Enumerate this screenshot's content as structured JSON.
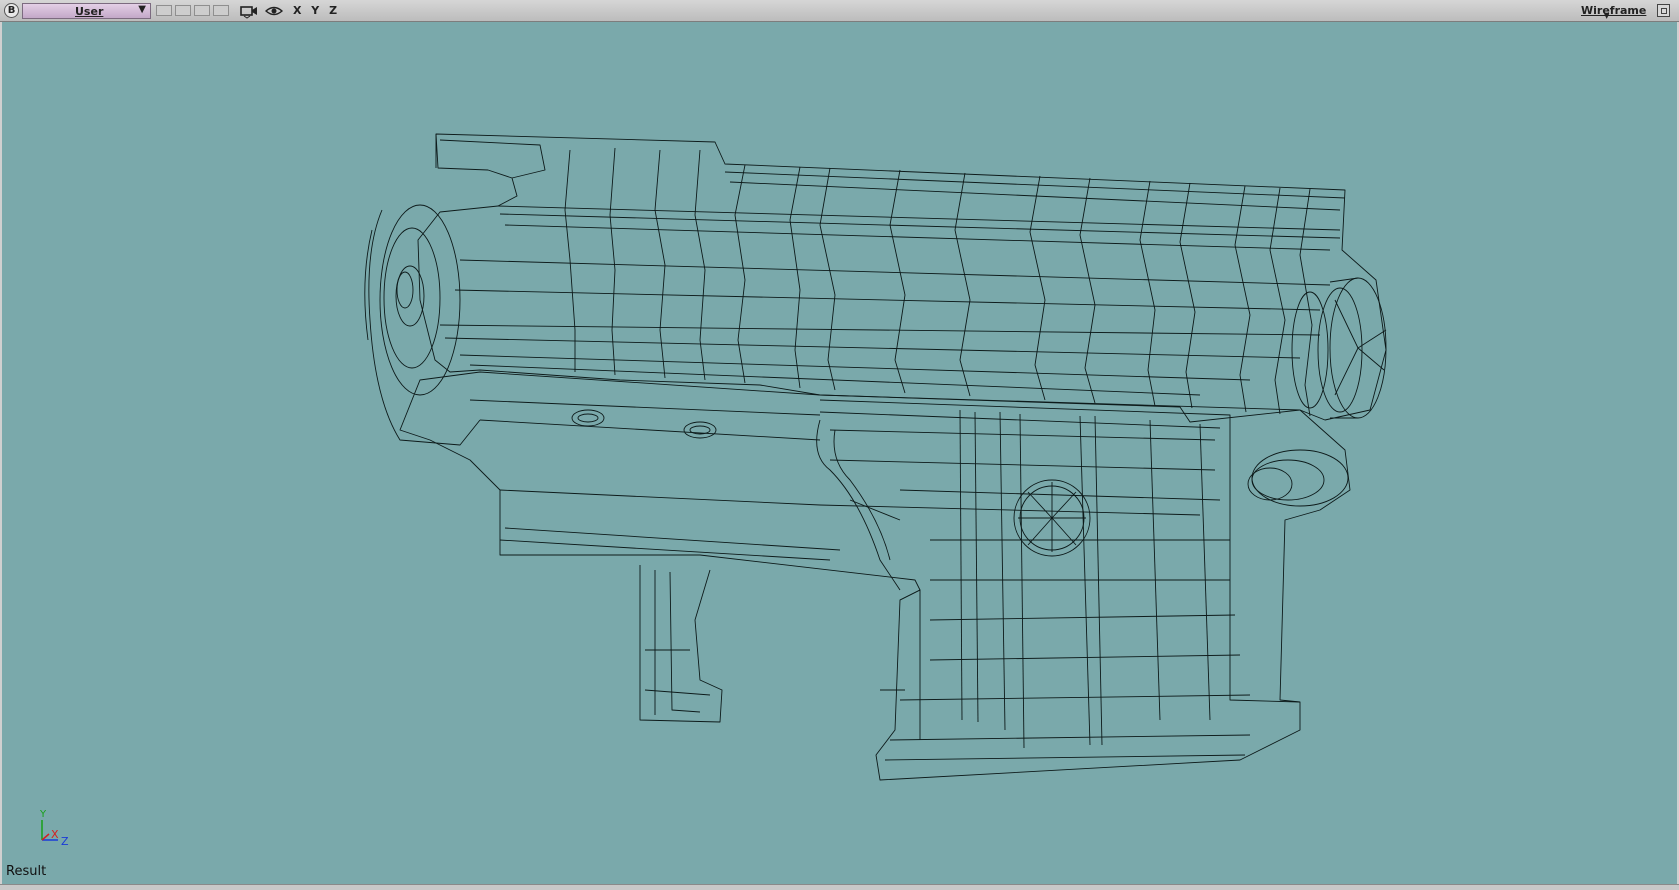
{
  "toolbar": {
    "badge": "B",
    "view_name": "User",
    "axes_label": "X Y Z",
    "shading_mode": "Wireframe",
    "icons": [
      "camera-icon",
      "eye-icon",
      "maximize-icon"
    ]
  },
  "viewport": {
    "background": "#7aa9ab",
    "status_label": "Result",
    "axis_labels": {
      "x": "X",
      "y": "Y",
      "z": "Z"
    },
    "axis_colors": {
      "x": "#d42020",
      "y": "#18a018",
      "z": "#1a3ad8"
    }
  }
}
